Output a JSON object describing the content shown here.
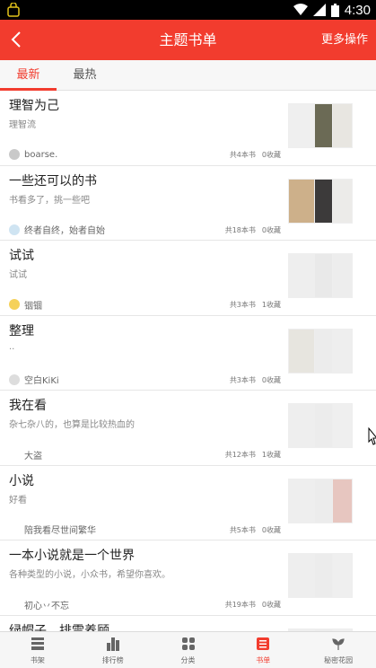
{
  "status_bar": {
    "time": "4:30",
    "battery_level": "100"
  },
  "app_bar": {
    "title": "主题书单",
    "more_label": "更多操作"
  },
  "tabs": [
    {
      "label": "最新",
      "active": true
    },
    {
      "label": "最热",
      "active": false
    }
  ],
  "booklists": [
    {
      "title": "理智为己",
      "desc": "理智流",
      "author": "boarse.",
      "books": "共4本书",
      "favs": "0收藏",
      "avatar_color": "#c9c9c9",
      "covers": [
        "#efefef",
        "#6b6a55",
        "#e8e6e1"
      ]
    },
    {
      "title": "一些还可以的书",
      "desc": "书看多了，挑一些吧",
      "author": "终者自终，始者自始",
      "books": "共18本书",
      "favs": "0收藏",
      "avatar_color": "#cfe4f2",
      "covers": [
        "#cdb08a",
        "#3c3a3a",
        "#ecebe9"
      ]
    },
    {
      "title": "试试",
      "desc": "试试",
      "author": "铟锢",
      "books": "共3本书",
      "favs": "1收藏",
      "avatar_color": "#f5d15a",
      "covers": [
        "#eeeeee",
        "#e9e9e9",
        "#ededed"
      ]
    },
    {
      "title": "整理",
      "desc": "..",
      "author": "空白KiKi",
      "books": "共3本书",
      "favs": "0收藏",
      "avatar_color": "#dddddd",
      "covers": [
        "#e7e5df",
        "#ececec",
        "#eeeeee"
      ]
    },
    {
      "title": "我在看",
      "desc": "杂七杂八的，也算是比较热血的",
      "author": "大盗",
      "books": "共12本书",
      "favs": "1收藏",
      "avatar_color": "#ffffff",
      "covers": [
        "#eeeeee",
        "#ececec",
        "#efefef"
      ]
    },
    {
      "title": "小说",
      "desc": "好看",
      "author": "陪我看尽世间繁华",
      "books": "共5本书",
      "favs": "0收藏",
      "avatar_color": "#ffffff",
      "covers": [
        "#eeeeee",
        "#ececec",
        "#e7c6c0"
      ]
    },
    {
      "title": "一本小说就是一个世界",
      "desc": "各种类型的小说，小众书，希望你喜欢。",
      "author": "初心丷不忘",
      "books": "共19本书",
      "favs": "0收藏",
      "avatar_color": "#ffffff",
      "covers": [
        "#eeeeee",
        "#ececec",
        "#efefef"
      ]
    },
    {
      "title": "绿帽子，排雷养顾",
      "desc": "",
      "author": "",
      "books": "",
      "favs": "",
      "avatar_color": "#ffffff",
      "covers": [
        "#eeeeee",
        "#ececec",
        "#efefef"
      ]
    }
  ],
  "bottom_nav": [
    {
      "label": "书架",
      "icon": "bookshelf-icon",
      "active": false
    },
    {
      "label": "排行榜",
      "icon": "ranking-icon",
      "active": false
    },
    {
      "label": "分类",
      "icon": "category-icon",
      "active": false
    },
    {
      "label": "书单",
      "icon": "booklist-icon",
      "active": true
    },
    {
      "label": "秘密花园",
      "icon": "garden-icon",
      "active": false
    }
  ],
  "colors": {
    "accent": "#f23c2e",
    "statusbar": "#000000"
  }
}
